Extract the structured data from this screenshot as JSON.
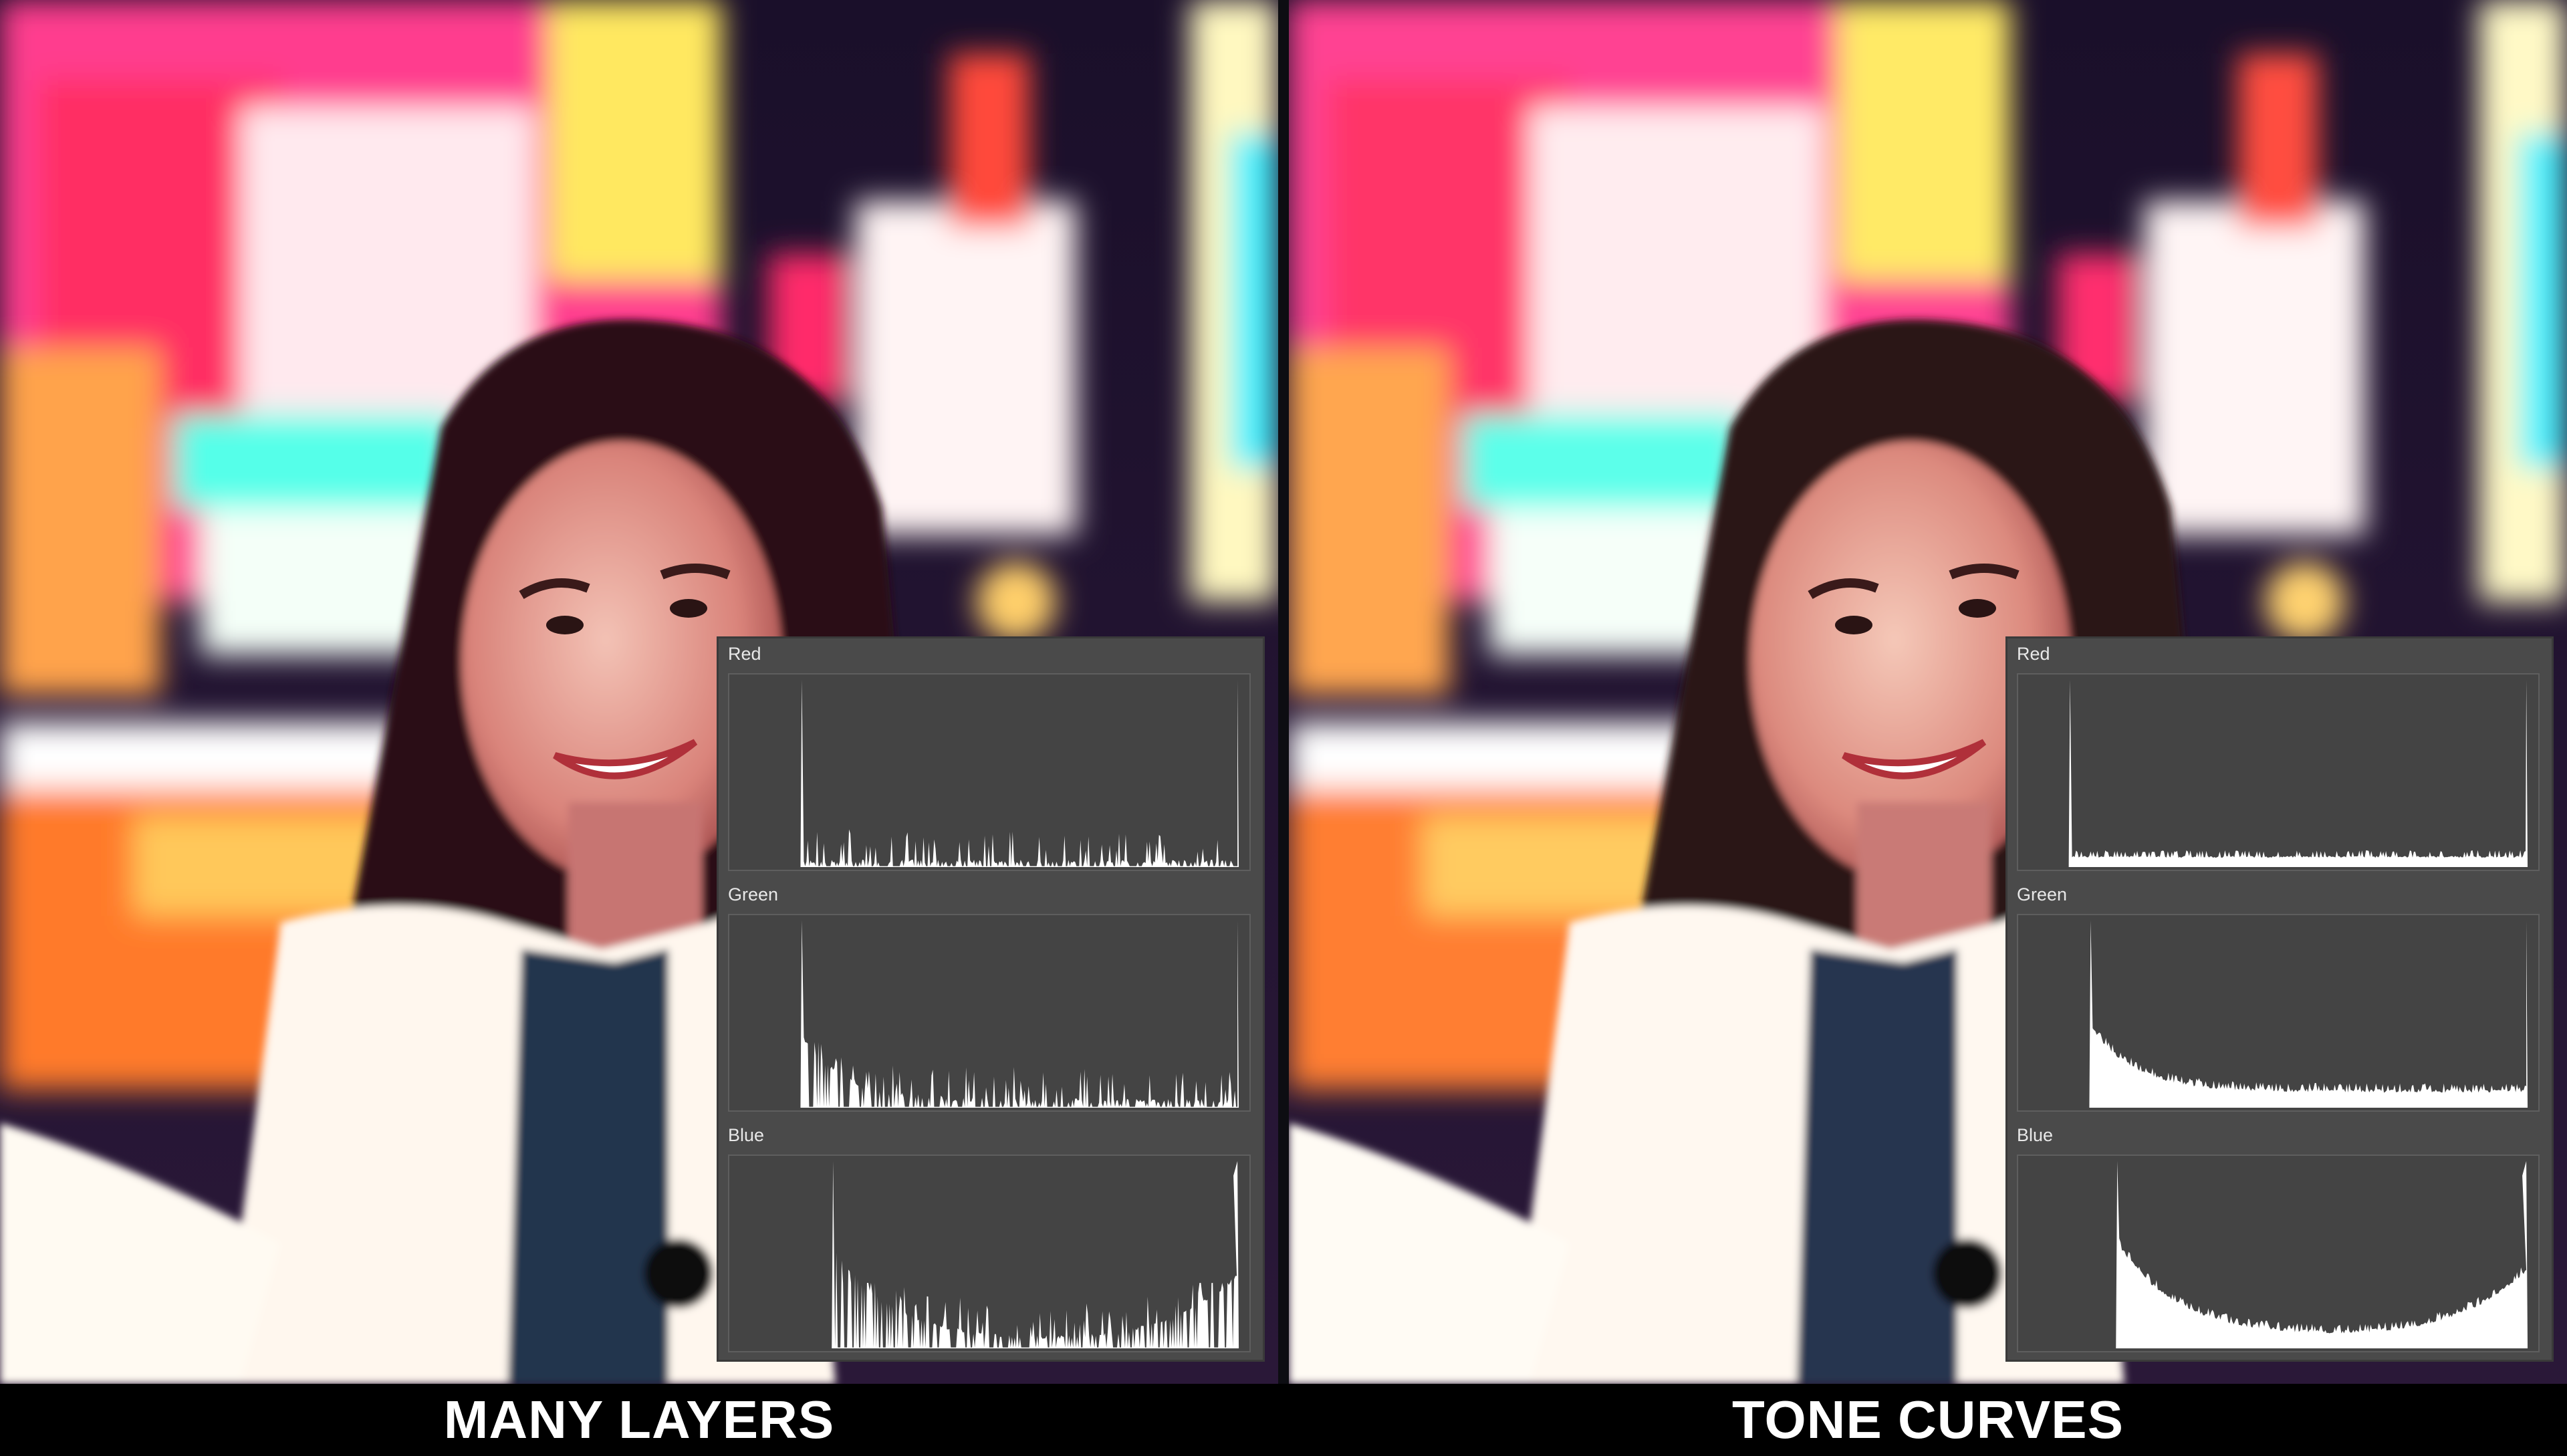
{
  "comparison": {
    "left": {
      "caption": "MANY LAYERS",
      "histogram": {
        "channels": [
          {
            "label": "Red",
            "profile": "comb-flat",
            "spike_at": 0.14,
            "comb": "sparse",
            "tail_spike": false
          },
          {
            "label": "Green",
            "profile": "comb-decay",
            "spike_at": 0.14,
            "comb": "sparse",
            "tail_spike": false
          },
          {
            "label": "Blue",
            "profile": "comb-valley",
            "spike_at": 0.2,
            "comb": "sparse",
            "tail_spike": true
          }
        ]
      }
    },
    "right": {
      "caption": "TONE CURVES",
      "histogram": {
        "channels": [
          {
            "label": "Red",
            "profile": "smooth-flat",
            "spike_at": 0.1,
            "comb": "dense",
            "tail_spike": false
          },
          {
            "label": "Green",
            "profile": "smooth-decay",
            "spike_at": 0.14,
            "comb": "dense",
            "tail_spike": false
          },
          {
            "label": "Blue",
            "profile": "smooth-valley",
            "spike_at": 0.19,
            "comb": "dense",
            "tail_spike": true
          }
        ]
      }
    }
  },
  "colors": {
    "histogram_fill": "#ffffff",
    "histogram_bg": "#444444",
    "panel_bg": "#4a4a4a",
    "caption_text": "#ffffff"
  }
}
